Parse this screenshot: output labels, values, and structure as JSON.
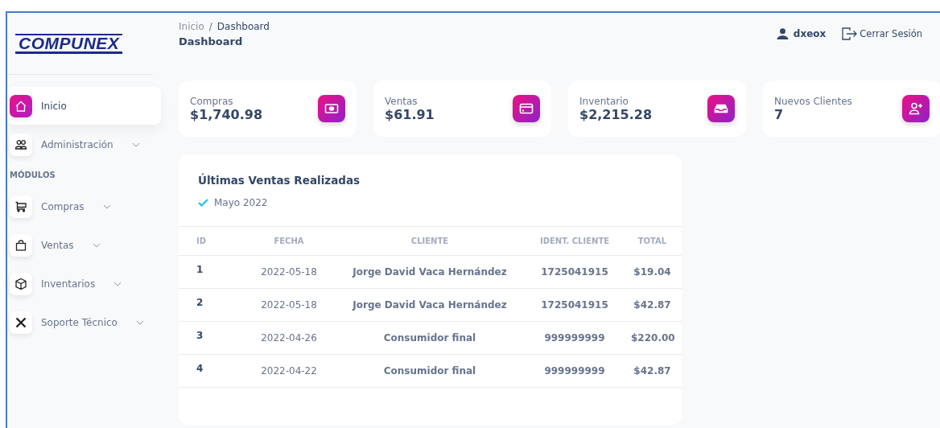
{
  "logo": {
    "text": "COMPUNEX"
  },
  "sidebar": {
    "items": [
      {
        "kind": "link",
        "label": "Inicio",
        "selected": true,
        "expandable": false
      },
      {
        "kind": "link",
        "label": "Administración",
        "selected": false,
        "expandable": true
      },
      {
        "kind": "heading",
        "label": "MÓDULOS"
      },
      {
        "kind": "link",
        "label": "Compras",
        "selected": false,
        "expandable": true
      },
      {
        "kind": "link",
        "label": "Ventas",
        "selected": false,
        "expandable": true
      },
      {
        "kind": "link",
        "label": "Inventarios",
        "selected": false,
        "expandable": true
      },
      {
        "kind": "link",
        "label": "Soporte Técnico",
        "selected": false,
        "expandable": true
      }
    ]
  },
  "breadcrumb": [
    "Inicio",
    "Dashboard"
  ],
  "breadcrumb_separator": "/",
  "page_title": "Dashboard",
  "user": {
    "name": "dxeox",
    "logout": "Cerrar Sesión"
  },
  "stats": [
    {
      "label": "Compras",
      "value": "$1,740.98"
    },
    {
      "label": "Ventas",
      "value": "$61.91"
    },
    {
      "label": "Inventario",
      "value": "$2,215.28"
    },
    {
      "label": "Nuevos Clientes",
      "value": "7"
    }
  ],
  "sales_card": {
    "title": "Últimas Ventas Realizadas",
    "subtitle": "Mayo 2022",
    "table": {
      "columns": [
        "ID",
        "FECHA",
        "CLIENTE",
        "IDENT. CLIENTE",
        "TOTAL"
      ],
      "rows": [
        [
          "1",
          "2022-05-18",
          "Jorge David Vaca Hernández",
          "1725041915",
          "$19.04"
        ],
        [
          "2",
          "2022-05-18",
          "Jorge David Vaca Hernández",
          "1725041915",
          "$42.87"
        ],
        [
          "3",
          "2022-04-26",
          "Consumidor final",
          "999999999",
          "$220.00"
        ],
        [
          "4",
          "2022-04-22",
          "Consumidor final",
          "999999999",
          "$42.87"
        ]
      ]
    }
  }
}
